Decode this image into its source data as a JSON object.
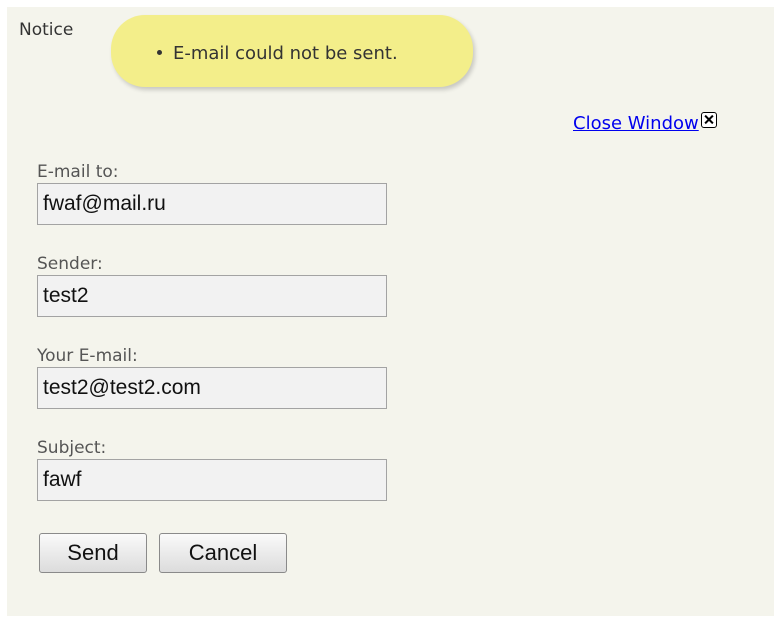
{
  "notice": {
    "label": "Notice",
    "messages": [
      "E-mail could not be sent."
    ]
  },
  "close_link": {
    "label": "Close Window"
  },
  "form": {
    "email_to": {
      "label": "E-mail to:",
      "value": "fwaf@mail.ru"
    },
    "sender": {
      "label": "Sender:",
      "value": "test2"
    },
    "your_email": {
      "label": "Your E-mail:",
      "value": "test2@test2.com"
    },
    "subject": {
      "label": "Subject:",
      "value": "fawf"
    }
  },
  "buttons": {
    "send": "Send",
    "cancel": "Cancel"
  },
  "colors": {
    "background": "#f4f4ec",
    "notice_bubble": "#f3ee8a",
    "link": "#0000ee"
  },
  "icons": [
    "close-icon"
  ]
}
